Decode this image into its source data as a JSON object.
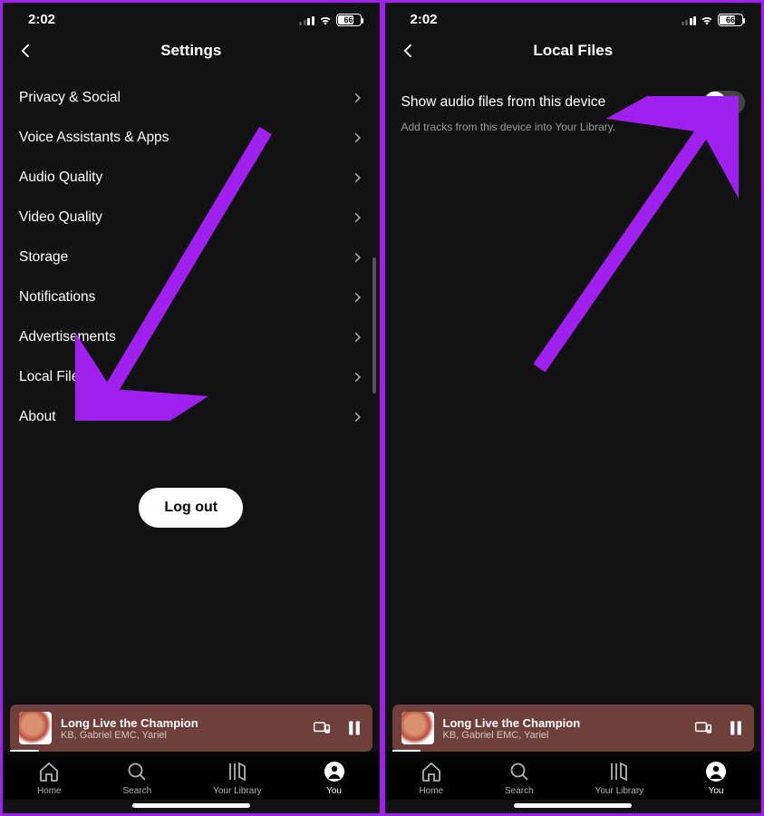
{
  "status": {
    "time": "2:02",
    "battery": "66"
  },
  "left": {
    "title": "Settings",
    "items": [
      "Privacy & Social",
      "Voice Assistants & Apps",
      "Audio Quality",
      "Video Quality",
      "Storage",
      "Notifications",
      "Advertisements",
      "Local Files",
      "About"
    ],
    "logout": "Log out"
  },
  "right": {
    "title": "Local Files",
    "toggle_label": "Show audio files from this device",
    "toggle_on": false,
    "subtext": "Add tracks from this device into Your Library."
  },
  "now_playing": {
    "title": "Long Live the Champion",
    "artist": "KB, Gabriel EMC, Yariel"
  },
  "nav": {
    "home": "Home",
    "search": "Search",
    "library": "Your Library",
    "you": "You"
  }
}
